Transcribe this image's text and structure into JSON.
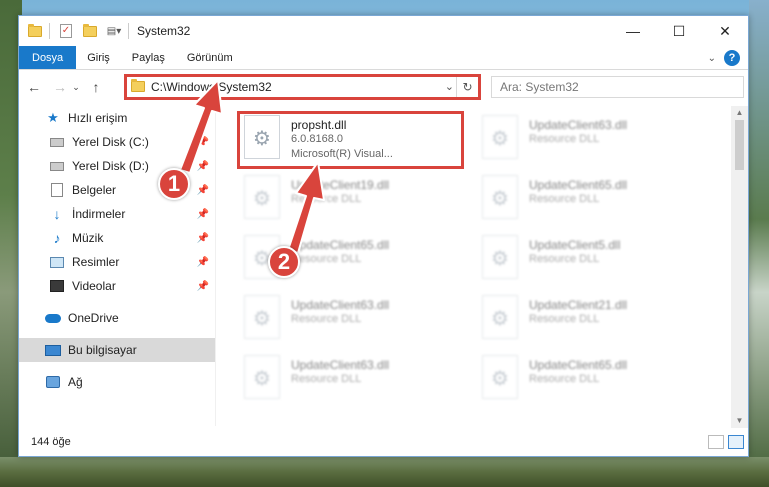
{
  "window": {
    "title": "System32",
    "controls": {
      "minimize": "—",
      "maximize": "☐",
      "close": "✕"
    }
  },
  "ribbon": {
    "tabs": [
      "Dosya",
      "Giriş",
      "Paylaş",
      "Görünüm"
    ],
    "help": "?"
  },
  "nav": {
    "back": "←",
    "forward": "→",
    "up": "↑",
    "address": "C:\\Windows\\System32",
    "refresh": "↻",
    "search_placeholder": "Ara: System32"
  },
  "sidebar": {
    "quick_access": "Hızlı erişim",
    "items": [
      {
        "label": "Yerel Disk (C:)",
        "icon": "drive-icon"
      },
      {
        "label": "Yerel Disk (D:)",
        "icon": "drive-icon"
      },
      {
        "label": "Belgeler",
        "icon": "documents-icon"
      },
      {
        "label": "İndirmeler",
        "icon": "download-icon"
      },
      {
        "label": "Müzik",
        "icon": "music-icon"
      },
      {
        "label": "Resimler",
        "icon": "pictures-icon"
      },
      {
        "label": "Videolar",
        "icon": "videos-icon"
      }
    ],
    "onedrive": "OneDrive",
    "this_pc": "Bu bilgisayar",
    "network": "Ağ"
  },
  "files": [
    {
      "name": "propsht.dll",
      "line2": "6.0.8168.0",
      "line3": "Microsoft(R) Visual..."
    },
    {
      "name": "UpdateClient63.dll",
      "line2": "Resource DLL"
    },
    {
      "name": "UpdateClient19.dll",
      "line2": "Resource DLL"
    },
    {
      "name": "UpdateClient65.dll",
      "line2": "Resource DLL"
    },
    {
      "name": "UpdateClient65.dll",
      "line2": "Resource DLL"
    },
    {
      "name": "UpdateClient5.dll",
      "line2": "Resource DLL"
    },
    {
      "name": "UpdateClient63.dll",
      "line2": "Resource DLL"
    },
    {
      "name": "UpdateClient21.dll",
      "line2": "Resource DLL"
    },
    {
      "name": "UpdateClient63.dll",
      "line2": "Resource DLL"
    },
    {
      "name": "UpdateClient65.dll",
      "line2": "Resource DLL"
    }
  ],
  "status": {
    "count": "144 öğe"
  },
  "callouts": [
    "1",
    "2"
  ],
  "colors": {
    "accent": "#1979ca",
    "highlight": "#d9443c"
  }
}
